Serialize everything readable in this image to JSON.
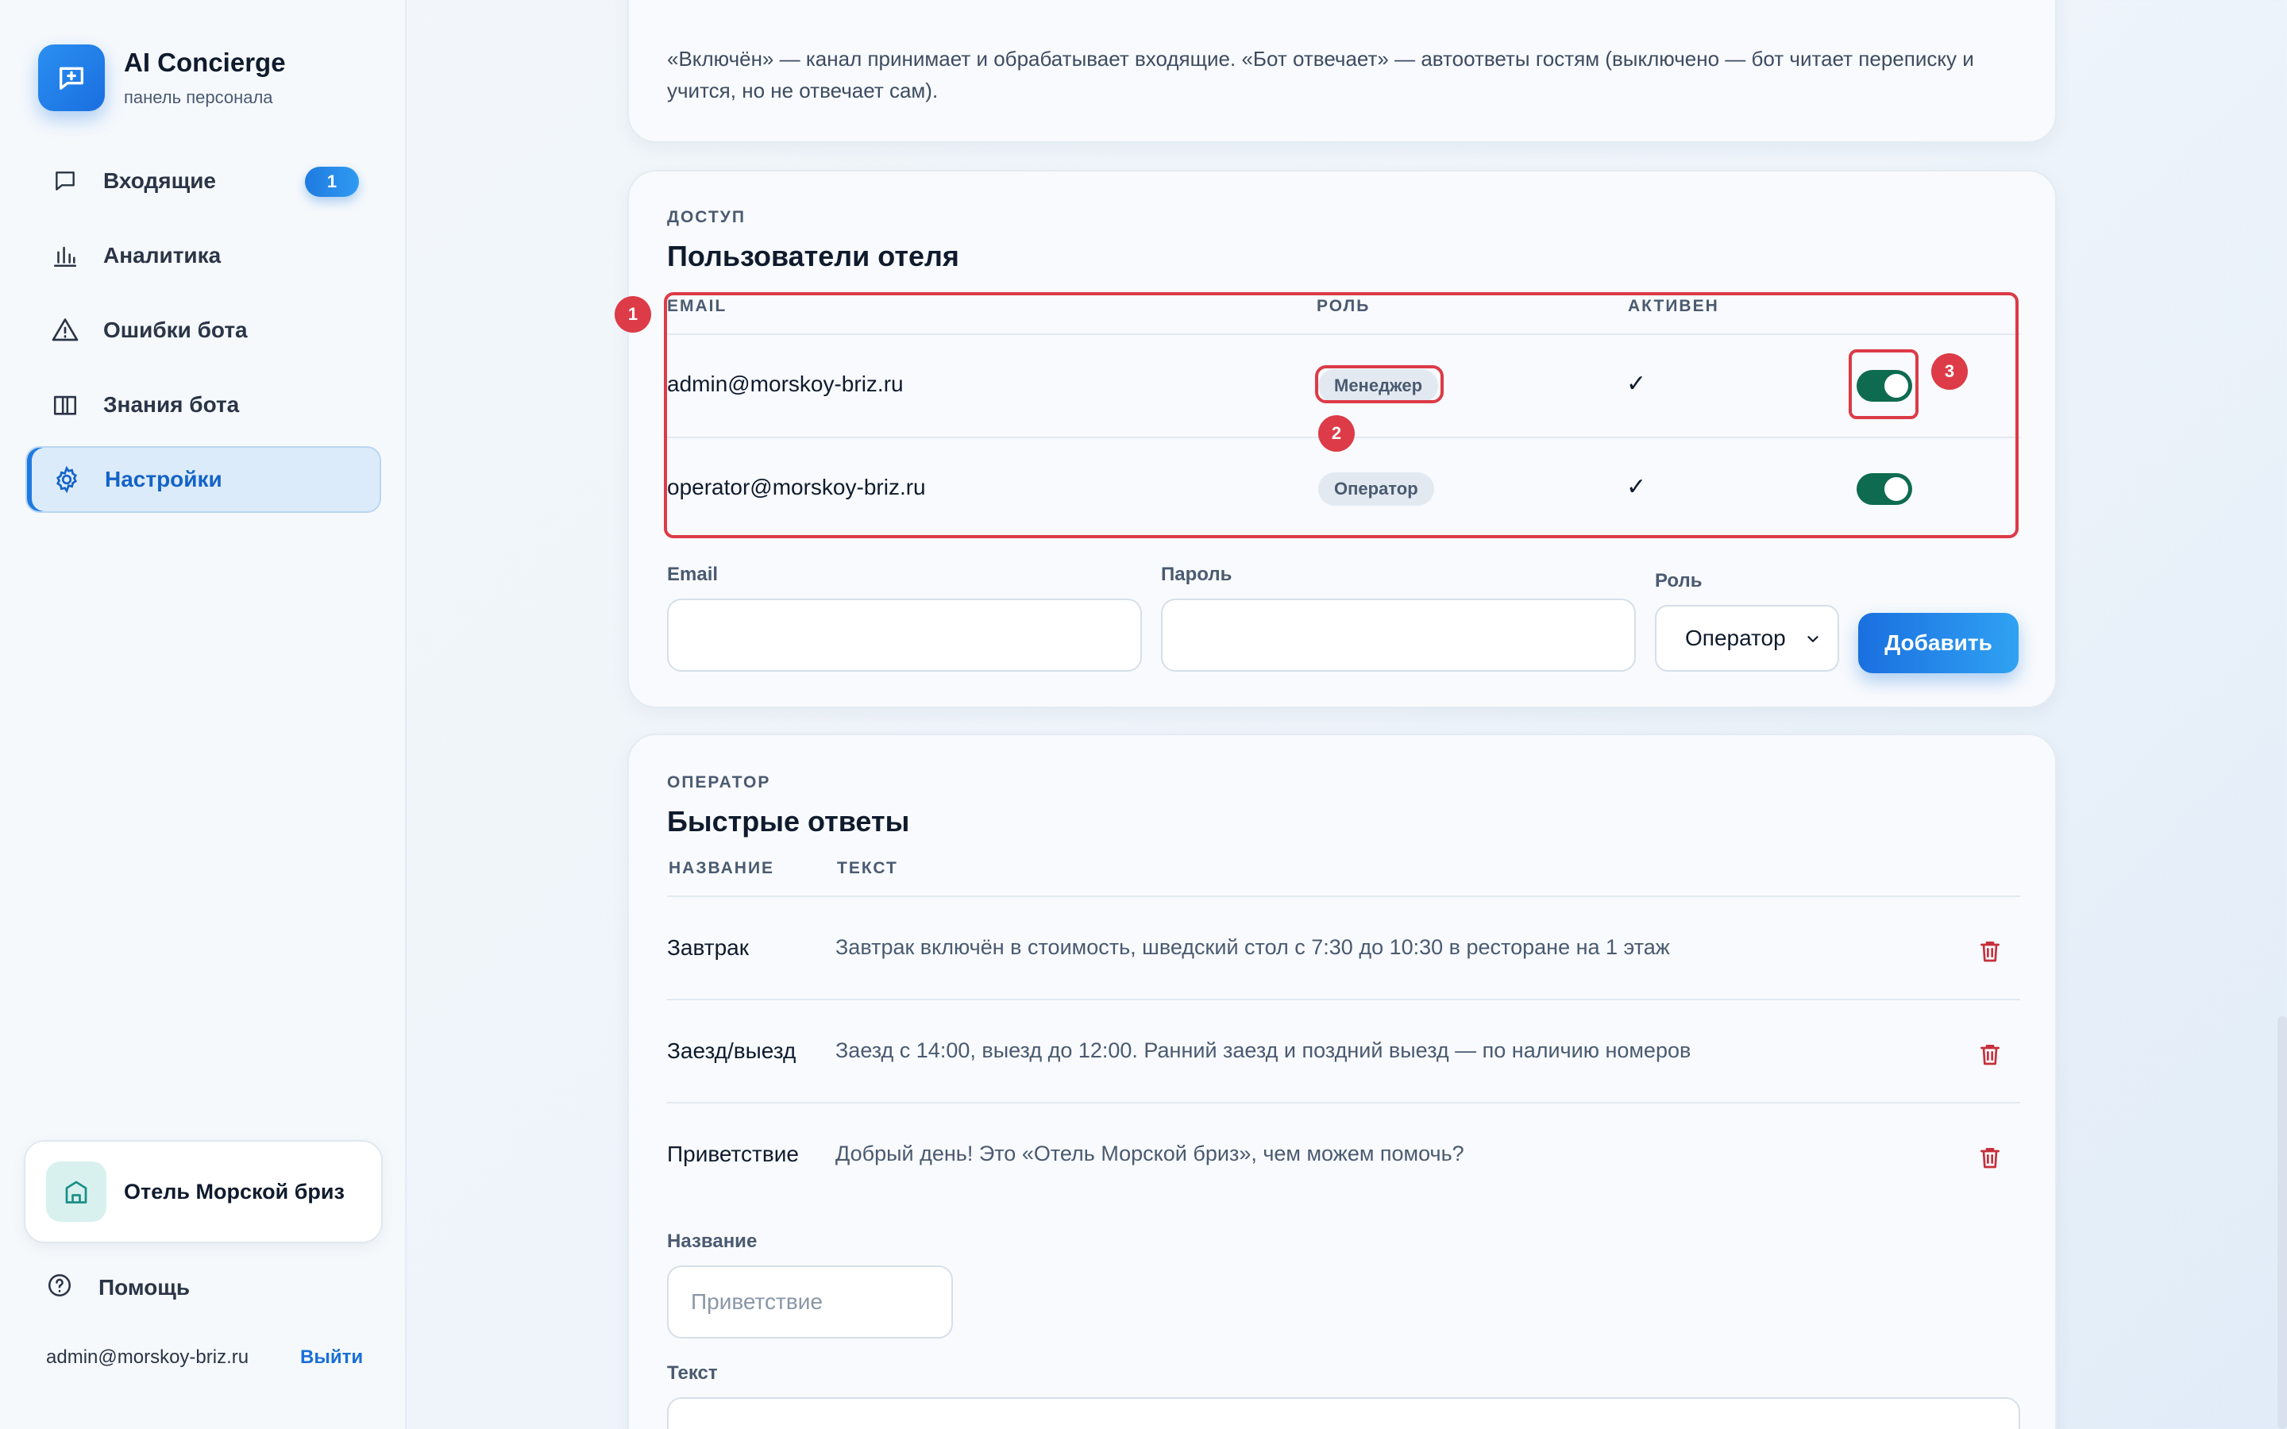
{
  "app": {
    "title": "AI Concierge",
    "subtitle": "панель персонала"
  },
  "sidebar": {
    "items": [
      {
        "label": "Входящие",
        "badge": "1",
        "icon": "chat-icon"
      },
      {
        "label": "Аналитика",
        "icon": "bar-chart-icon"
      },
      {
        "label": "Ошибки бота",
        "icon": "warning-icon"
      },
      {
        "label": "Знания бота",
        "icon": "book-icon"
      },
      {
        "label": "Настройки",
        "icon": "gear-icon",
        "active": true
      }
    ],
    "hotel": {
      "name": "Отель Морской бриз",
      "icon": "building-icon"
    },
    "help": {
      "label": "Помощь",
      "icon": "help-circle-icon"
    },
    "user": {
      "email": "admin@morskoy-briz.ru",
      "logout": "Выйти"
    }
  },
  "channels_card": {
    "note": "«Включён» — канал принимает и обрабатывает входящие. «Бот отвечает» — автоответы гостям (выключено — бот читает переписку и учится, но не отвечает сам)."
  },
  "users_card": {
    "eyebrow": "ДОСТУП",
    "title": "Пользователи отеля",
    "columns": {
      "email": "EMAIL",
      "role": "РОЛЬ",
      "active": "АКТИВЕН"
    },
    "rows": [
      {
        "email": "admin@morskoy-briz.ru",
        "role": "Менеджер",
        "active": "✓",
        "enabled": true
      },
      {
        "email": "operator@morskoy-briz.ru",
        "role": "Оператор",
        "active": "✓",
        "enabled": true
      }
    ],
    "form": {
      "email_label": "Email",
      "email_value": "",
      "password_label": "Пароль",
      "password_value": "",
      "role_label": "Роль",
      "role_value": "Оператор",
      "add_button": "Добавить"
    }
  },
  "quick_card": {
    "eyebrow": "ОПЕРАТОР",
    "title": "Быстрые ответы",
    "columns": {
      "name": "НАЗВАНИЕ",
      "text": "ТЕКСТ"
    },
    "rows": [
      {
        "name": "Завтрак",
        "text": "Завтрак включён в стоимость, шведский стол с 7:30 до 10:30 в ресторане на 1 этаж"
      },
      {
        "name": "Заезд/выезд",
        "text": "Заезд с 14:00, выезд до 12:00. Ранний заезд и поздний выезд — по наличию номеров"
      },
      {
        "name": "Приветствие",
        "text": "Добрый день! Это «Отель Морской бриз», чем можем помочь?"
      }
    ],
    "form": {
      "name_label": "Название",
      "name_placeholder": "Приветствие",
      "text_label": "Текст"
    }
  },
  "annotations": [
    "1",
    "2",
    "3"
  ],
  "colors": {
    "accent": "#1f7ae0",
    "toggle_on": "#0f6b4f",
    "annotation": "#dc3b47"
  }
}
